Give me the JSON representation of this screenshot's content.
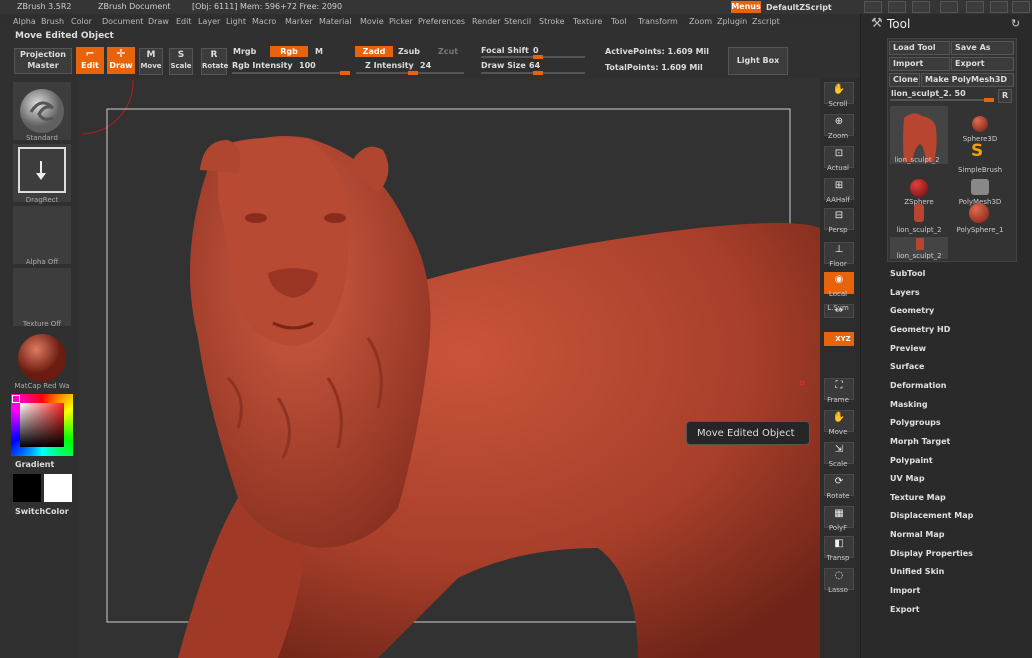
{
  "titlebar": {
    "app": "ZBrush 3.5R2",
    "doc": "ZBrush Document",
    "stats": "[Obj: 6111] Mem: 596+72 Free: 2090",
    "menus_btn": "Menus",
    "script": "DefaultZScript"
  },
  "menus": [
    "Alpha",
    "Brush",
    "Color",
    "Document",
    "Draw",
    "Edit",
    "Layer",
    "Light",
    "Macro",
    "Marker",
    "Material",
    "Movie",
    "Picker",
    "Preferences",
    "Render",
    "Stencil",
    "Stroke",
    "Texture",
    "Tool",
    "Transform",
    "Zoom",
    "Zplugin",
    "Zscript"
  ],
  "status": "Move Edited Object",
  "toolbar": {
    "projection_master": "Projection Master",
    "edit": "Edit",
    "draw": "Draw",
    "move": "Move",
    "scale": "Scale",
    "rotate": "Rotate",
    "mrgb": "Mrgb",
    "rgb": "Rgb",
    "m": "M",
    "zadd": "Zadd",
    "zsub": "Zsub",
    "zcut": "Zcut",
    "rgb_intensity_label": "Rgb Intensity",
    "rgb_intensity_value": "100",
    "z_intensity_label": "Z Intensity",
    "z_intensity_value": "24",
    "focal_shift_label": "Focal Shift",
    "focal_shift_value": "0",
    "draw_size_label": "Draw Size",
    "draw_size_value": "64",
    "active_points": "ActivePoints: 1.609 Mil",
    "total_points": "TotalPoints: 1.609 Mil",
    "light_box": "Light Box"
  },
  "left": {
    "standard": "Standard",
    "dragrect": "DragRect",
    "alpha_off": "Alpha Off",
    "texture_off": "Texture Off",
    "matcap": "MatCap Red Wa",
    "gradient": "Gradient",
    "switchcolor": "SwitchColor"
  },
  "right": [
    "Scroll",
    "Zoom",
    "Actual",
    "AAHalf",
    "Persp",
    "Floor",
    "Local",
    "L.Sym",
    "XYZ",
    "Frame",
    "Move",
    "Scale",
    "Rotate",
    "PolyF",
    "Transp",
    "Lasso"
  ],
  "tooltip": "Move Edited Object",
  "tool": {
    "title": "Tool",
    "load": "Load Tool",
    "save": "Save As",
    "import": "Import",
    "export": "Export",
    "clone": "Clone",
    "make": "Make PolyMesh3D",
    "current": "lion_sculpt_2. 50",
    "r": "R",
    "thumbs": [
      "lion_sculpt_2",
      "Sphere3D",
      "SimpleBrush",
      "ZSphere",
      "PolyMesh3D",
      "lion_sculpt_2",
      "PolySphere_1",
      "lion_sculpt_2"
    ],
    "sections": [
      "SubTool",
      "Layers",
      "Geometry",
      "Geometry HD",
      "Preview",
      "Surface",
      "Deformation",
      "Masking",
      "Polygroups",
      "Morph Target",
      "Polypaint",
      "UV Map",
      "Texture Map",
      "Displacement Map",
      "Normal Map",
      "Display Properties",
      "Unified Skin",
      "Import",
      "Export"
    ]
  },
  "colors": {
    "accent": "#e8640c",
    "clay": "#b8452f"
  }
}
